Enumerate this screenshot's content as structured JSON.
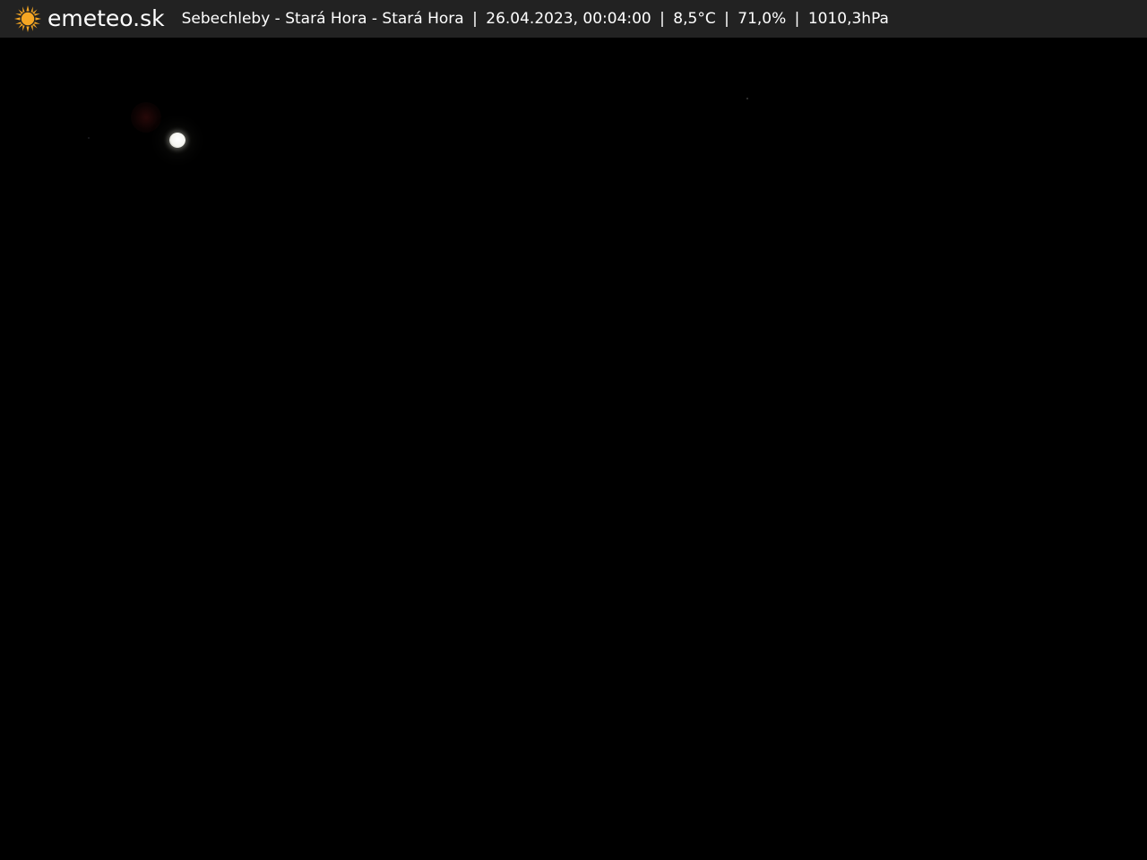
{
  "header": {
    "brand": "emeteo.sk",
    "logo_icon": "sun-icon",
    "logo_color": "#f5a623",
    "location": "Sebechleby - Stará Hora - Stará Hora",
    "timestamp": "26.04.2023, 00:04:00",
    "temperature": "8,5°C",
    "humidity": "71,0%",
    "pressure": "1010,3hPa",
    "separator": "|"
  },
  "scene": {
    "subject": "moon-icon"
  }
}
